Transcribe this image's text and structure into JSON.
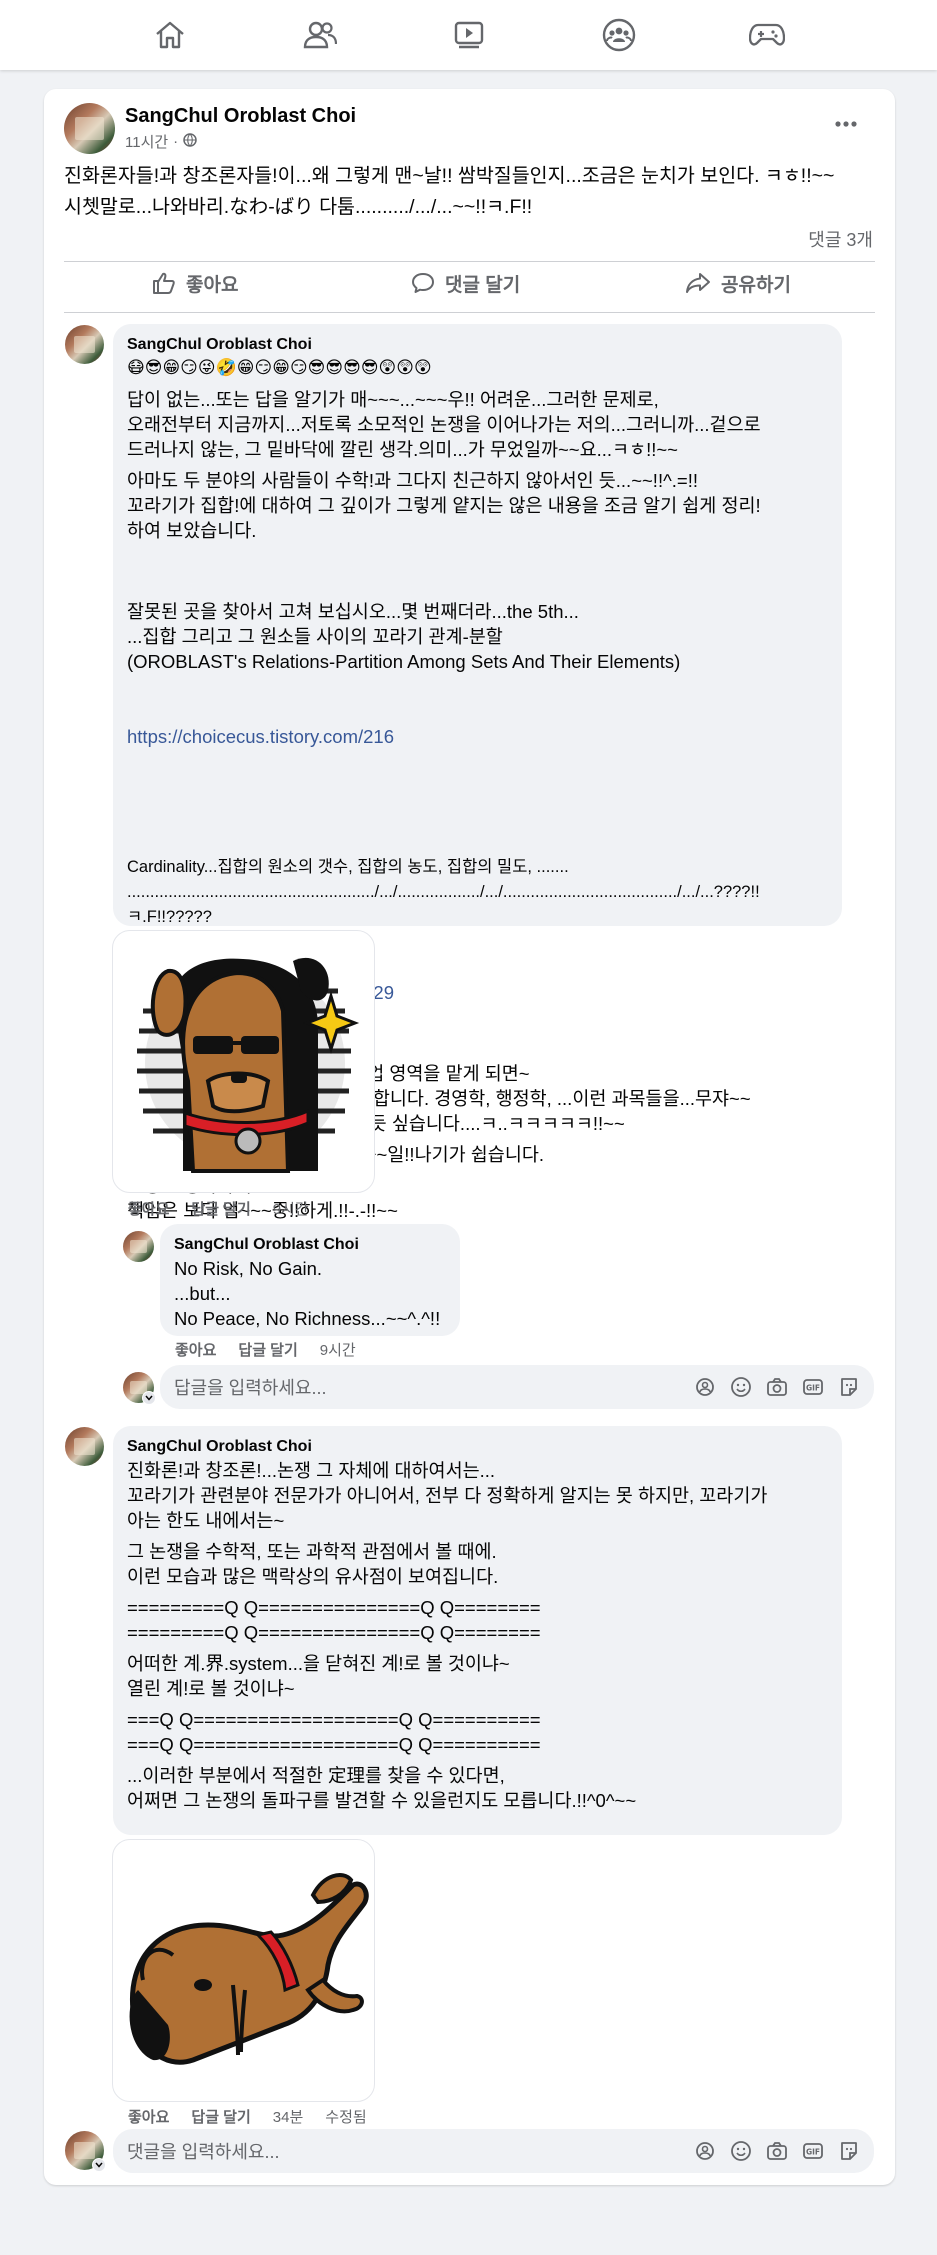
{
  "nav": {
    "items": [
      "home-icon",
      "friends-icon",
      "watch-icon",
      "groups-icon",
      "gaming-icon"
    ]
  },
  "post": {
    "author": "SangChul Oroblast Choi",
    "time": "11시간",
    "privacy_separator": "·",
    "text_line1": "진화론자들!과 창조론자들!이...왜 그렇게 맨~날!! 쌈박질들인지...조금은 눈치가 보인다. ㅋㅎ!!~~",
    "text_line2": "시쳇말로...나와바리.なわ-ばり 다툼........../.../...~~!!ㅋ.F!!",
    "comment_count": "댓글 3개",
    "actions": {
      "like": "좋아요",
      "comment": "댓글 달기",
      "share": "공유하기"
    }
  },
  "comment1": {
    "author": "SangChul Oroblast Choi",
    "emojis": "😷😎😁😏😜🤣😁😏😁😏😎😎😎😎😲😲😲",
    "p1": "답이 없는...또는 답을 알기가 매~~~...~~~우!! 어려운...그러한 문제로,\n오래전부터 지금까지...저토록 소모적인 논쟁을 이어나가는 저의...그러니까...겉으로\n드러나지 않는, 그 밑바닥에 깔린 생각.의미...가 무었일까~~요...ㅋㅎ!!~~",
    "p2": "아마도 두 분야의 사람들이 수학!과 그다지 친근하지 않아서인 듯...~~!!^.=!!\n꼬라기가 집합!에 대하여 그 깊이가 그렇게 얕지는 않은 내용을 조금 알기 쉽게 정리!\n하여 보았습니다.",
    "p3": "잘못된 곳을 찾아서 고쳐 보십시오...몇 번째더라...the 5th...\n...집합 그리고 그 원소들 사이의 꼬라기 관계-분할\n(OROBLAST's Relations-Partition Among Sets And Their Elements)",
    "link1": "https://choicecus.tistory.com/216",
    "p4": "Cardinality...집합의 원소의 갯수, 집합의 농도, 집합의 밀도, .......\n....................................................../.../................../.../....................................../.../...????!!ㅋ.F!!?????",
    "link2": "https://choicecus.tistory.com/129",
    "p5": "그리고 나와바리...그러니까...사업 영역을 맡게 되면~\n잘~ 관리!를 하여 발전을 시켜야 합니다. 경영학, 행정학, ...이런 과목들을...무쟈~~\n게!!! 열~쉬!!미!!! 공부하셔야 할 듯 싶습니다....ㅋ..ㅋㅋㅋㅋㅋ!!~~",
    "p6": "x리는 데로...아무렇게나 하면, 큰~일!!나기가 쉽습니다.",
    "p7": "보상은 정확하게.\n책임은 보다 엄~~~중!!하게.!!-.-!!~~",
    "like": "좋아요",
    "reply": "답글 달기",
    "time": "9시간"
  },
  "reply1": {
    "author": "SangChul Oroblast Choi",
    "text": "No Risk, No Gain.\n...but...\nNo Peace, No Richness...~~^.^!!",
    "like": "좋아요",
    "reply": "답글 달기",
    "time": "9시간"
  },
  "reply_input": {
    "placeholder": "답글을 입력하세요..."
  },
  "comment2": {
    "author": "SangChul Oroblast Choi",
    "p1": "진화론!과 창조론!...논쟁 그 자체에 대하여서는...\n꼬라기가 관련분야 전문가가 아니어서, 전부 다 정확하게 알지는 못 하지만, 꼬라기가\n아는 한도 내에서는~",
    "p2": "그 논쟁을 수학적, 또는 과학적 관점에서 볼 때에.\n이런 모습과 많은 맥락상의 유사점이 보여집니다.",
    "p3": "=========Q Q===============Q Q========\n=========Q Q===============Q Q========",
    "p4": "어떠한 계.界.system...을 닫혀진 계!로 볼 것이냐~\n열린 계!로 볼 것이냐~",
    "p5": "===Q Q===================Q Q==========\n===Q Q===================Q Q==========",
    "p6": "...이러한 부분에서 적절한 定理를 찾을 수 있다면,\n어쩌면 그 논쟁의 돌파구를 발견할 수 있을런지도 모릅니다.!!^0^~~",
    "like": "좋아요",
    "reply": "답글 달기",
    "time": "34분",
    "edited": "수정됨"
  },
  "comment_input": {
    "placeholder": "댓글을 입력하세요..."
  },
  "colors": {
    "link": "#385898",
    "meta": "#65676b",
    "bubble": "#f0f2f5"
  }
}
